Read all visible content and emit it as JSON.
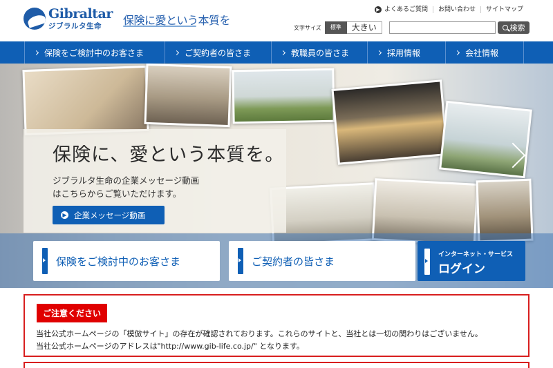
{
  "header": {
    "logo_en": "Gibraltar",
    "logo_ja": "ジブラルタ生命",
    "slogan": "保険に愛という本質を",
    "util_links": [
      "よくあるご質問",
      "お問い合わせ",
      "サイトマップ"
    ],
    "fontsize_label": "文字サイズ",
    "fontsize_normal": "標準",
    "fontsize_large": "大きい",
    "search_value": "",
    "search_button": "検索"
  },
  "nav": {
    "items": [
      "保険をご検討中のお客さま",
      "ご契約者の皆さま",
      "教職員の皆さま",
      "採用情報",
      "会社情報"
    ]
  },
  "hero": {
    "title": "保険に、愛という本質を。",
    "text_line1": "ジブラルタ生命の企業メッセージ動画",
    "text_line2": "はこちらからご覧いただけます。",
    "button_label": "企業メッセージ動画"
  },
  "cards": {
    "prospect": "保険をご検討中のお客さま",
    "contractor": "ご契約者の皆さま",
    "login_sub": "インターネット・サービス",
    "login_main": "ログイン"
  },
  "notice": {
    "title": "ご注意ください",
    "line1": "当社公式ホームページの「模倣サイト」の存在が確認されております。これらのサイトと、当社とは一切の関わりはございません。",
    "line2": "当社公式ホームページのアドレスは\"http://www.gib-life.co.jp/\" となります。"
  },
  "colors": {
    "brand_blue": "#0f5fb5",
    "alert_red": "#e00000"
  }
}
